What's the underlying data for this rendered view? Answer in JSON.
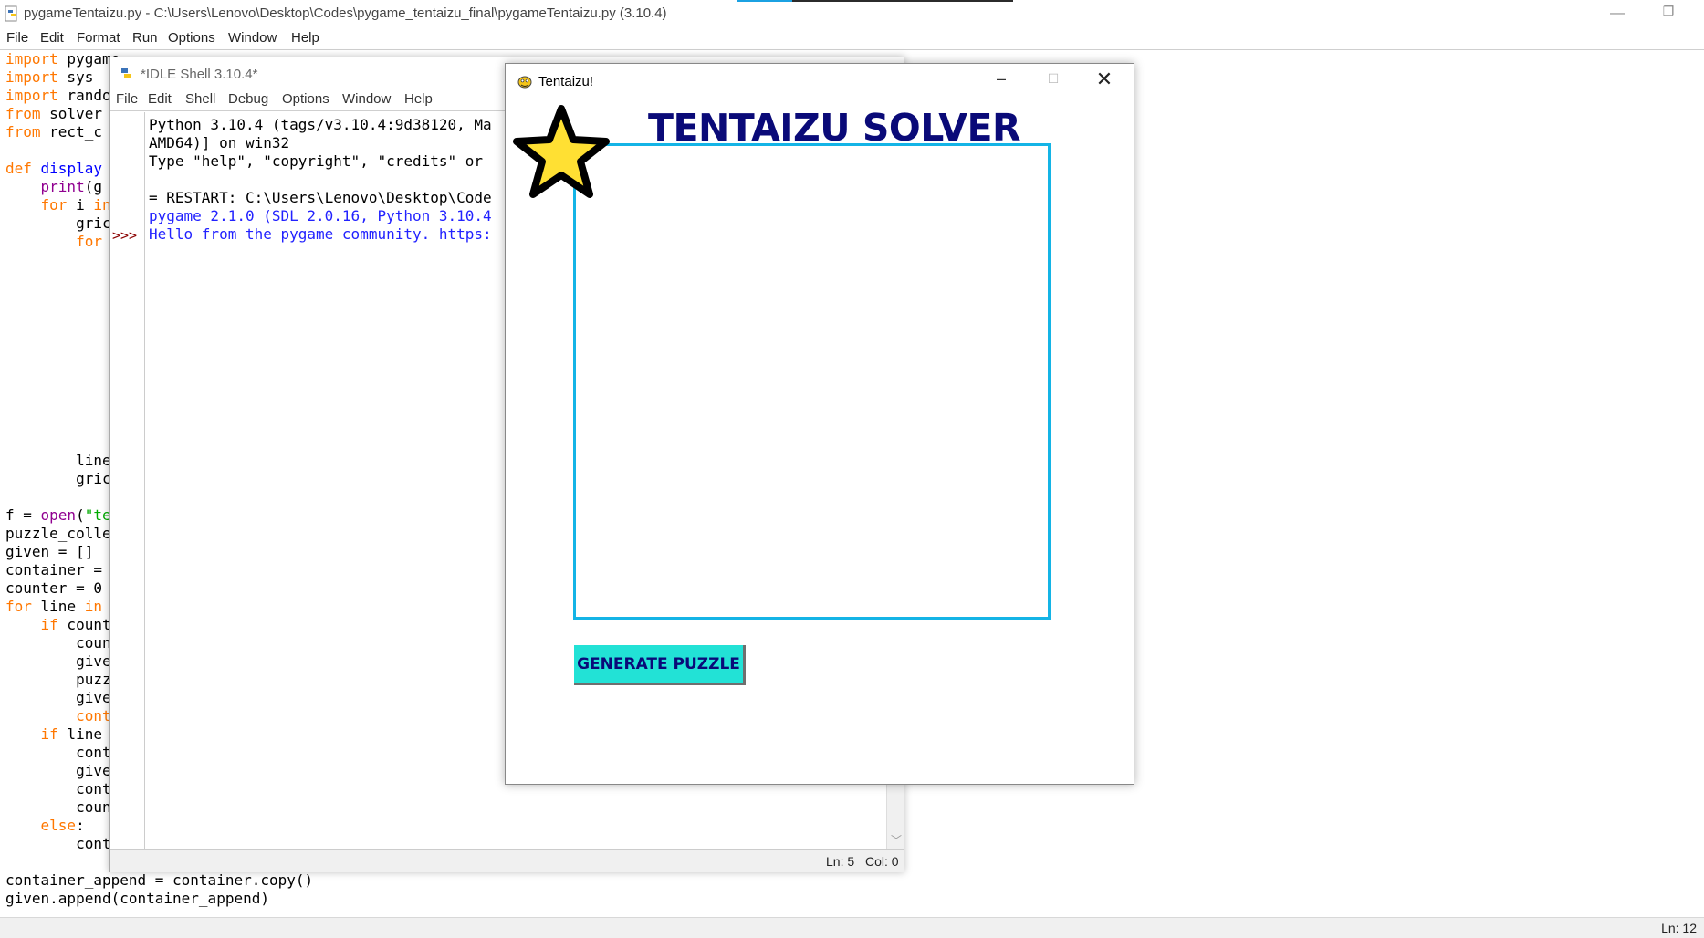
{
  "editor": {
    "title": "pygameTentaizu.py - C:\\Users\\Lenovo\\Desktop\\Codes\\pygame_tentaizu_final\\pygameTentaizu.py (3.10.4)",
    "menu": [
      "File",
      "Edit",
      "Format",
      "Run",
      "Options",
      "Window",
      "Help"
    ],
    "status": "Ln: 12",
    "code": {
      "l1a": "import",
      "l1b": " pygame",
      "l2a": "import",
      "l2b": " sys",
      "l3a": "import",
      "l3b": " rando",
      "l4a": "from",
      "l4b": " solver",
      "l5a": "from",
      "l5b": " rect_c",
      "l7a": "def",
      "l7b": " display",
      "l8a": "    ",
      "l8b": "print",
      "l8c": "(g",
      "l9a": "    ",
      "l9b": "for",
      "l9c": " i ",
      "l9d": "in",
      "l10": "        gric",
      "l11a": "        ",
      "l11b": "for",
      "l23": "        line",
      "l24": "        gric",
      "l26a": "f = ",
      "l26b": "open",
      "l26c": "(",
      "l26d": "\"te",
      "l27": "puzzle_colle",
      "l28": "given = []",
      "l29": "container = ",
      "l30": "counter = 0",
      "l31a": "for",
      "l31b": " line ",
      "l31c": "in",
      "l32a": "    ",
      "l32b": "if",
      "l32c": " count",
      "l33": "        coun",
      "l34": "        give",
      "l35": "        puzz",
      "l36": "        give",
      "l37a": "        ",
      "l37b": "cont",
      "l38a": "    ",
      "l38b": "if",
      "l38c": " line",
      "l39": "        cont",
      "l40": "        give",
      "l41": "        cont",
      "l42": "        coun",
      "l43a": "    ",
      "l43b": "else",
      "l43c": ":",
      "l44": "        cont",
      "l46": "container_append = container.copy()",
      "l47": "given.append(container_append)"
    }
  },
  "shell": {
    "title": "*IDLE Shell 3.10.4*",
    "menu": [
      "File",
      "Edit",
      "Shell",
      "Debug",
      "Options",
      "Window",
      "Help"
    ],
    "prompt": ">>>",
    "lines": [
      "Python 3.10.4 (tags/v3.10.4:9d38120, Ma",
      "AMD64)] on win32",
      "Type \"help\", \"copyright\", \"credits\" or",
      "",
      "= RESTART: C:\\Users\\Lenovo\\Desktop\\Code",
      "pygame 2.1.0 (SDL 2.0.16, Python 3.10.4",
      "Hello from the pygame community. https:"
    ],
    "status_ln": "Ln: 5",
    "status_col": "Col: 0"
  },
  "pygame": {
    "window_title": "Tentaizu!",
    "heading": "TENTAIZU SOLVER",
    "button_label": "GENERATE PUZZLE"
  },
  "colors": {
    "heading": "#0a0a78",
    "board_border": "#14b4e6",
    "button_bg": "#22e2d6",
    "star_fill": "#ffe033",
    "keyword": "#ff7700",
    "builtin": "#900090",
    "string": "#00aa00",
    "definition": "#0000ff",
    "shell_output": "#2222ff"
  }
}
